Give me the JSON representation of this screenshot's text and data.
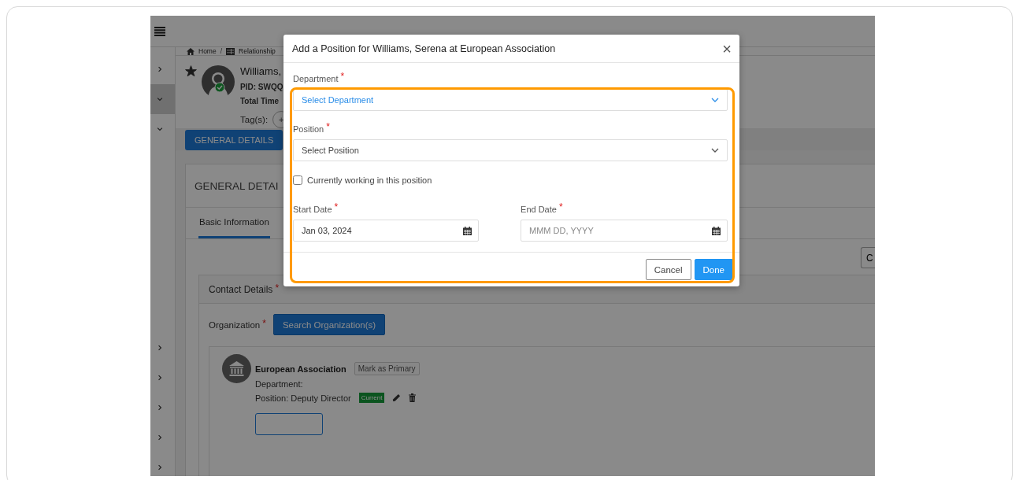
{
  "sidebar": {
    "top_items": [
      {
        "expanded": false,
        "selected": false
      },
      {
        "expanded": true,
        "selected": true
      },
      {
        "expanded": true,
        "selected": false
      }
    ],
    "bottom_items": [
      {
        "expanded": false,
        "selected": false
      },
      {
        "expanded": false,
        "selected": false
      },
      {
        "expanded": false,
        "selected": false
      },
      {
        "expanded": false,
        "selected": false
      },
      {
        "expanded": false,
        "selected": false
      }
    ]
  },
  "breadcrumb": {
    "items": [
      "Home",
      "Relationship"
    ],
    "separator": "/"
  },
  "profile": {
    "name": "Williams,",
    "pid": "PID: SWQQ",
    "total_time": "Total Time",
    "tags_label": "Tag(s):",
    "add_tag": "+",
    "verified": true,
    "starred": true
  },
  "tabs": [
    {
      "label": "GENERAL DETAILS",
      "selected": true
    }
  ],
  "card": {
    "title": "GENERAL DETAI",
    "subtabs": [
      {
        "label": "Basic Information",
        "selected": true
      }
    ],
    "side_button": "C"
  },
  "contact": {
    "title": "Contact Details",
    "mark": "*",
    "organization_label": "Organization",
    "organization_mark": "*",
    "search_button": "Search Organization(s)",
    "org": {
      "name": "European Association",
      "primary_button": "Mark as Primary",
      "department": "Department:",
      "position": "Position: Deputy Director",
      "status": "Current"
    }
  },
  "modal": {
    "title": "Add a Position for Williams, Serena at European Association",
    "close": "×",
    "selects": [
      {
        "label": "Department",
        "mark": "*",
        "placeholder": "Select Department",
        "focused": true
      },
      {
        "label": "Position",
        "mark": "*",
        "placeholder": "Select Position",
        "focused": false
      }
    ],
    "checkbox": {
      "label": "Currently working in this position",
      "checked": false
    },
    "dates": [
      {
        "label": "Start Date",
        "mark": "*",
        "value": "Jan 03, 2024"
      },
      {
        "label": "End Date",
        "mark": "*",
        "placeholder": "MMM DD, YYYY"
      }
    ],
    "buttons": [
      {
        "label": "Cancel",
        "kind": "secondary"
      },
      {
        "label": "Done",
        "kind": "primary"
      }
    ]
  }
}
